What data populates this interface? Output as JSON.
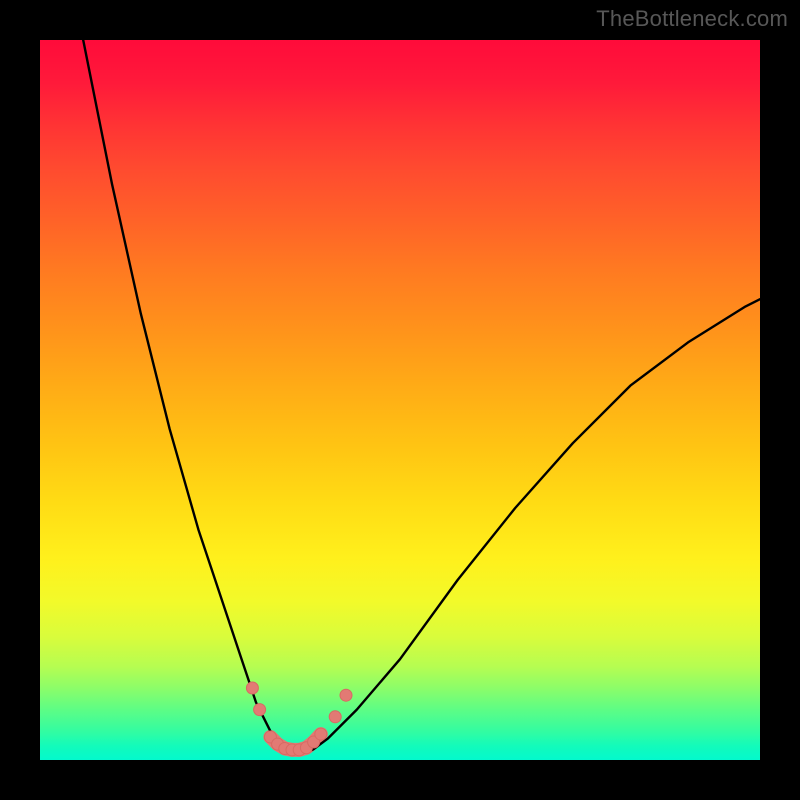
{
  "watermark": "TheBottleneck.com",
  "colors": {
    "background": "#000000",
    "curve_stroke": "#000000",
    "marker_fill": "#e27a74",
    "marker_stroke": "#d86a63",
    "gradient_top": "#ff0b3a",
    "gradient_bottom": "#03f9cd"
  },
  "chart_data": {
    "type": "line",
    "title": "",
    "xlabel": "",
    "ylabel": "",
    "xlim": [
      0,
      100
    ],
    "ylim": [
      0,
      100
    ],
    "grid": false,
    "series": [
      {
        "name": "bottleneck-curve",
        "x": [
          6,
          8,
          10,
          12,
          14,
          16,
          18,
          20,
          22,
          24,
          26,
          27,
          28,
          29,
          30,
          31,
          32,
          33,
          34,
          35,
          36,
          37,
          38,
          40,
          44,
          50,
          58,
          66,
          74,
          82,
          90,
          98,
          100
        ],
        "y": [
          100,
          90,
          80,
          71,
          62,
          54,
          46,
          39,
          32,
          26,
          20,
          17,
          14,
          11,
          8,
          6,
          4,
          2.5,
          1.5,
          1,
          1,
          1,
          1.5,
          3,
          7,
          14,
          25,
          35,
          44,
          52,
          58,
          63,
          64
        ]
      }
    ],
    "markers": {
      "name": "highlight-band",
      "points": [
        {
          "x": 29.5,
          "y": 10
        },
        {
          "x": 30.5,
          "y": 7
        },
        {
          "x": 32,
          "y": 3.2
        },
        {
          "x": 33,
          "y": 2.2
        },
        {
          "x": 34,
          "y": 1.6
        },
        {
          "x": 35,
          "y": 1.4
        },
        {
          "x": 36,
          "y": 1.4
        },
        {
          "x": 37,
          "y": 1.7
        },
        {
          "x": 38,
          "y": 2.5
        },
        {
          "x": 39,
          "y": 3.6
        },
        {
          "x": 41,
          "y": 6
        },
        {
          "x": 42.5,
          "y": 9
        }
      ],
      "point_radius": 6,
      "connector_width": 14
    }
  }
}
